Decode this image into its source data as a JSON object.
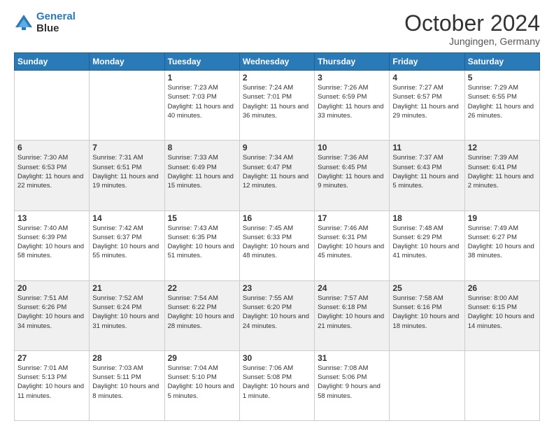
{
  "header": {
    "logo_line1": "General",
    "logo_line2": "Blue",
    "month": "October 2024",
    "location": "Jungingen, Germany"
  },
  "weekdays": [
    "Sunday",
    "Monday",
    "Tuesday",
    "Wednesday",
    "Thursday",
    "Friday",
    "Saturday"
  ],
  "weeks": [
    [
      {
        "day": "",
        "info": ""
      },
      {
        "day": "",
        "info": ""
      },
      {
        "day": "1",
        "info": "Sunrise: 7:23 AM\nSunset: 7:03 PM\nDaylight: 11 hours and 40 minutes."
      },
      {
        "day": "2",
        "info": "Sunrise: 7:24 AM\nSunset: 7:01 PM\nDaylight: 11 hours and 36 minutes."
      },
      {
        "day": "3",
        "info": "Sunrise: 7:26 AM\nSunset: 6:59 PM\nDaylight: 11 hours and 33 minutes."
      },
      {
        "day": "4",
        "info": "Sunrise: 7:27 AM\nSunset: 6:57 PM\nDaylight: 11 hours and 29 minutes."
      },
      {
        "day": "5",
        "info": "Sunrise: 7:29 AM\nSunset: 6:55 PM\nDaylight: 11 hours and 26 minutes."
      }
    ],
    [
      {
        "day": "6",
        "info": "Sunrise: 7:30 AM\nSunset: 6:53 PM\nDaylight: 11 hours and 22 minutes."
      },
      {
        "day": "7",
        "info": "Sunrise: 7:31 AM\nSunset: 6:51 PM\nDaylight: 11 hours and 19 minutes."
      },
      {
        "day": "8",
        "info": "Sunrise: 7:33 AM\nSunset: 6:49 PM\nDaylight: 11 hours and 15 minutes."
      },
      {
        "day": "9",
        "info": "Sunrise: 7:34 AM\nSunset: 6:47 PM\nDaylight: 11 hours and 12 minutes."
      },
      {
        "day": "10",
        "info": "Sunrise: 7:36 AM\nSunset: 6:45 PM\nDaylight: 11 hours and 9 minutes."
      },
      {
        "day": "11",
        "info": "Sunrise: 7:37 AM\nSunset: 6:43 PM\nDaylight: 11 hours and 5 minutes."
      },
      {
        "day": "12",
        "info": "Sunrise: 7:39 AM\nSunset: 6:41 PM\nDaylight: 11 hours and 2 minutes."
      }
    ],
    [
      {
        "day": "13",
        "info": "Sunrise: 7:40 AM\nSunset: 6:39 PM\nDaylight: 10 hours and 58 minutes."
      },
      {
        "day": "14",
        "info": "Sunrise: 7:42 AM\nSunset: 6:37 PM\nDaylight: 10 hours and 55 minutes."
      },
      {
        "day": "15",
        "info": "Sunrise: 7:43 AM\nSunset: 6:35 PM\nDaylight: 10 hours and 51 minutes."
      },
      {
        "day": "16",
        "info": "Sunrise: 7:45 AM\nSunset: 6:33 PM\nDaylight: 10 hours and 48 minutes."
      },
      {
        "day": "17",
        "info": "Sunrise: 7:46 AM\nSunset: 6:31 PM\nDaylight: 10 hours and 45 minutes."
      },
      {
        "day": "18",
        "info": "Sunrise: 7:48 AM\nSunset: 6:29 PM\nDaylight: 10 hours and 41 minutes."
      },
      {
        "day": "19",
        "info": "Sunrise: 7:49 AM\nSunset: 6:27 PM\nDaylight: 10 hours and 38 minutes."
      }
    ],
    [
      {
        "day": "20",
        "info": "Sunrise: 7:51 AM\nSunset: 6:26 PM\nDaylight: 10 hours and 34 minutes."
      },
      {
        "day": "21",
        "info": "Sunrise: 7:52 AM\nSunset: 6:24 PM\nDaylight: 10 hours and 31 minutes."
      },
      {
        "day": "22",
        "info": "Sunrise: 7:54 AM\nSunset: 6:22 PM\nDaylight: 10 hours and 28 minutes."
      },
      {
        "day": "23",
        "info": "Sunrise: 7:55 AM\nSunset: 6:20 PM\nDaylight: 10 hours and 24 minutes."
      },
      {
        "day": "24",
        "info": "Sunrise: 7:57 AM\nSunset: 6:18 PM\nDaylight: 10 hours and 21 minutes."
      },
      {
        "day": "25",
        "info": "Sunrise: 7:58 AM\nSunset: 6:16 PM\nDaylight: 10 hours and 18 minutes."
      },
      {
        "day": "26",
        "info": "Sunrise: 8:00 AM\nSunset: 6:15 PM\nDaylight: 10 hours and 14 minutes."
      }
    ],
    [
      {
        "day": "27",
        "info": "Sunrise: 7:01 AM\nSunset: 5:13 PM\nDaylight: 10 hours and 11 minutes."
      },
      {
        "day": "28",
        "info": "Sunrise: 7:03 AM\nSunset: 5:11 PM\nDaylight: 10 hours and 8 minutes."
      },
      {
        "day": "29",
        "info": "Sunrise: 7:04 AM\nSunset: 5:10 PM\nDaylight: 10 hours and 5 minutes."
      },
      {
        "day": "30",
        "info": "Sunrise: 7:06 AM\nSunset: 5:08 PM\nDaylight: 10 hours and 1 minute."
      },
      {
        "day": "31",
        "info": "Sunrise: 7:08 AM\nSunset: 5:06 PM\nDaylight: 9 hours and 58 minutes."
      },
      {
        "day": "",
        "info": ""
      },
      {
        "day": "",
        "info": ""
      }
    ]
  ]
}
